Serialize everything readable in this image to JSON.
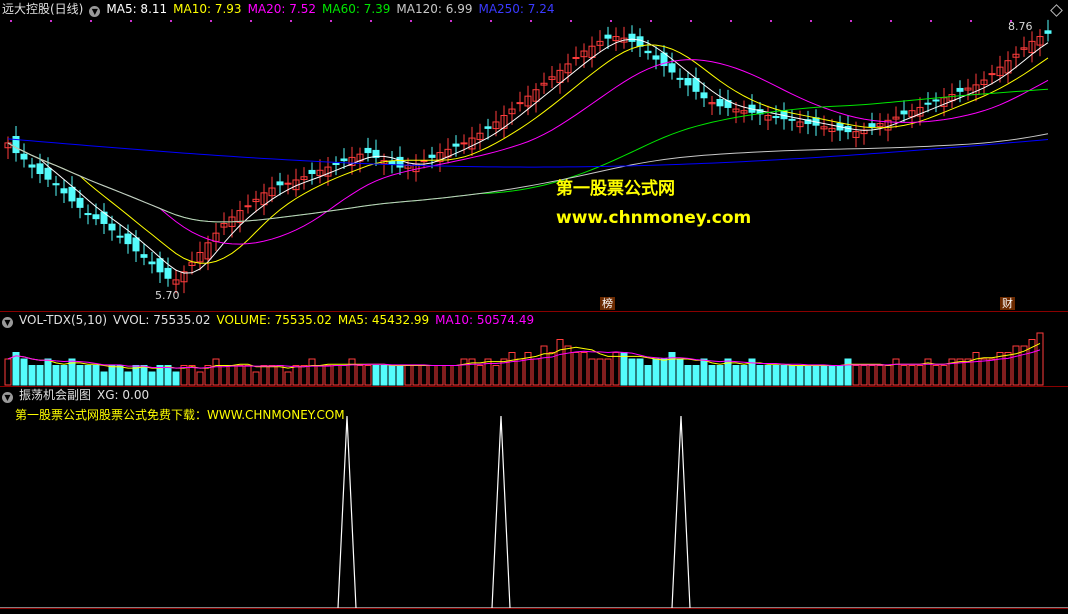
{
  "colors": {
    "up": "#ff3c3c",
    "down": "#54fcfc",
    "ma5": "#ffffff",
    "ma10": "#ffff00",
    "ma20": "#ff00ff",
    "ma60": "#00e600",
    "ma120": "#c8c8c8",
    "ma250": "#0000ff",
    "xg": "#ffffff"
  },
  "main": {
    "title": "远大控股(日线)",
    "ma5": "MA5: 8.11",
    "ma10": "MA10: 7.93",
    "ma20": "MA20: 7.52",
    "ma60": "MA60: 7.39",
    "ma120": "MA120: 6.99",
    "ma250": "MA250: 7.24",
    "high_label": "8.76",
    "low_label": "5.70",
    "tag_bang": "榜",
    "tag_cai": "财",
    "watermark_cn": "第一股票公式网",
    "watermark_url": "www.chnmoney.com"
  },
  "volume": {
    "name": "VOL-TDX(5,10)",
    "vvol": "VVOL: 75535.02",
    "volume": "VOLUME: 75535.02",
    "ma5": "MA5: 45432.99",
    "ma10": "MA10: 50574.49"
  },
  "sub": {
    "name": "振荡机会副图",
    "xg": "XG: 0.00",
    "download": "第一股票公式网股票公式免费下载：WWW.CHNMONEY.COM"
  },
  "series": {
    "closes": [
      7.4,
      7.28,
      7.2,
      7.1,
      7.02,
      6.95,
      6.88,
      6.78,
      6.68,
      6.6,
      6.52,
      6.46,
      6.4,
      6.32,
      6.24,
      6.15,
      6.06,
      5.98,
      5.9,
      5.8,
      5.72,
      5.7,
      5.8,
      5.92,
      6.04,
      6.16,
      6.28,
      6.4,
      6.48,
      6.56,
      6.62,
      6.7,
      6.78,
      6.84,
      6.88,
      6.9,
      6.94,
      6.98,
      7.02,
      7.06,
      7.1,
      7.14,
      7.18,
      7.22,
      7.26,
      7.28,
      7.22,
      7.18,
      7.14,
      7.1,
      7.12,
      7.14,
      7.18,
      7.22,
      7.28,
      7.32,
      7.36,
      7.4,
      7.46,
      7.52,
      7.58,
      7.66,
      7.74,
      7.82,
      7.9,
      7.98,
      8.06,
      8.14,
      8.22,
      8.3,
      8.38,
      8.46,
      8.54,
      8.6,
      8.66,
      8.7,
      8.72,
      8.7,
      8.66,
      8.6,
      8.52,
      8.44,
      8.36,
      8.28,
      8.2,
      8.12,
      8.04,
      7.96,
      7.9,
      7.86,
      7.84,
      7.82,
      7.8,
      7.78,
      7.76,
      7.74,
      7.72,
      7.7,
      7.68,
      7.66,
      7.64,
      7.62,
      7.6,
      7.58,
      7.56,
      7.54,
      7.54,
      7.56,
      7.6,
      7.64,
      7.68,
      7.72,
      7.76,
      7.8,
      7.84,
      7.88,
      7.92,
      7.96,
      8.0,
      8.04,
      8.08,
      8.12,
      8.18,
      8.26,
      8.34,
      8.42,
      8.5,
      8.58,
      8.66,
      8.72,
      8.76
    ],
    "volume": [
      4,
      5,
      4,
      3,
      3,
      4,
      3,
      3,
      4,
      3,
      3,
      3,
      2,
      3,
      3,
      2,
      3,
      3,
      2,
      3,
      3,
      2,
      3,
      3,
      2,
      3,
      4,
      3,
      3,
      3,
      3,
      2,
      3,
      3,
      3,
      2,
      3,
      3,
      4,
      3,
      3,
      3,
      3,
      4,
      3,
      3,
      3,
      3,
      3,
      3,
      3,
      3,
      3,
      3,
      3,
      3,
      3,
      4,
      4,
      3,
      4,
      3,
      4,
      5,
      4,
      5,
      4,
      6,
      5,
      7,
      6,
      5,
      5,
      4,
      4,
      4,
      5,
      5,
      4,
      4,
      3,
      4,
      4,
      5,
      4,
      3,
      3,
      4,
      3,
      3,
      4,
      3,
      3,
      4,
      3,
      3,
      3,
      3,
      3,
      3,
      3,
      3,
      3,
      3,
      3,
      4,
      3,
      3,
      3,
      3,
      3,
      4,
      3,
      3,
      3,
      4,
      3,
      3,
      4,
      4,
      4,
      5,
      4,
      4,
      5,
      5,
      6,
      6,
      7,
      8
    ],
    "spikes": [
      347,
      501,
      681
    ]
  }
}
